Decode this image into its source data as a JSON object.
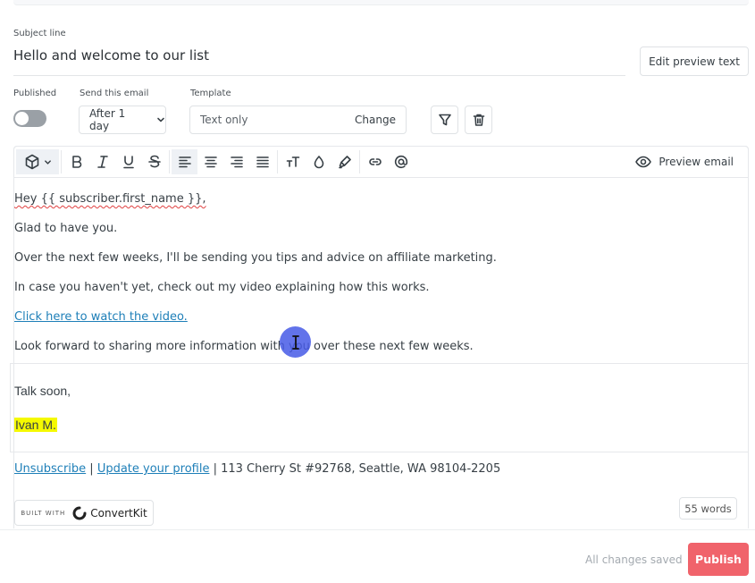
{
  "subject": {
    "label": "Subject line",
    "value": "Hello and welcome to our list"
  },
  "edit_preview_label": "Edit preview text",
  "published": {
    "label": "Published",
    "on": false
  },
  "send": {
    "label": "Send this email",
    "value": "After 1 day"
  },
  "template": {
    "label": "Template",
    "value": "Text only",
    "change_label": "Change"
  },
  "toolbar": {
    "icons": [
      "block-icon",
      "bold-icon",
      "italic-icon",
      "underline-icon",
      "strikethrough-icon",
      "align-left-icon",
      "align-center-icon",
      "align-right-icon",
      "align-justify-icon",
      "text-size-icon",
      "color-icon",
      "highlight-icon",
      "link-icon",
      "mention-icon"
    ],
    "preview_label": "Preview email"
  },
  "body": {
    "lines": [
      "Hey {{ subscriber.first_name }},",
      "Glad to have you.",
      "Over the next few weeks, I'll be sending you tips and advice on affiliate marketing.",
      "In case you haven't yet, check out my video explaining how this works.",
      "Click here to watch the video.",
      "Look forward to sharing more information with you over these next few weeks."
    ]
  },
  "signature": {
    "closing": "Talk soon,",
    "name": "Ivan M.",
    "highlight_color": "#f5f900"
  },
  "footer": {
    "unsubscribe": "Unsubscribe",
    "sep": " | ",
    "update_profile": "Update your profile",
    "address": " | 113 Cherry St #92768, Seattle, WA 98104-2205"
  },
  "badge": {
    "built_with": "BUILT WITH",
    "brand": "ConvertKit"
  },
  "word_count": "55 words",
  "status": "All changes saved",
  "publish_label": "Publish",
  "colors": {
    "accent": "#f0636b",
    "link": "#1e7fb8"
  }
}
